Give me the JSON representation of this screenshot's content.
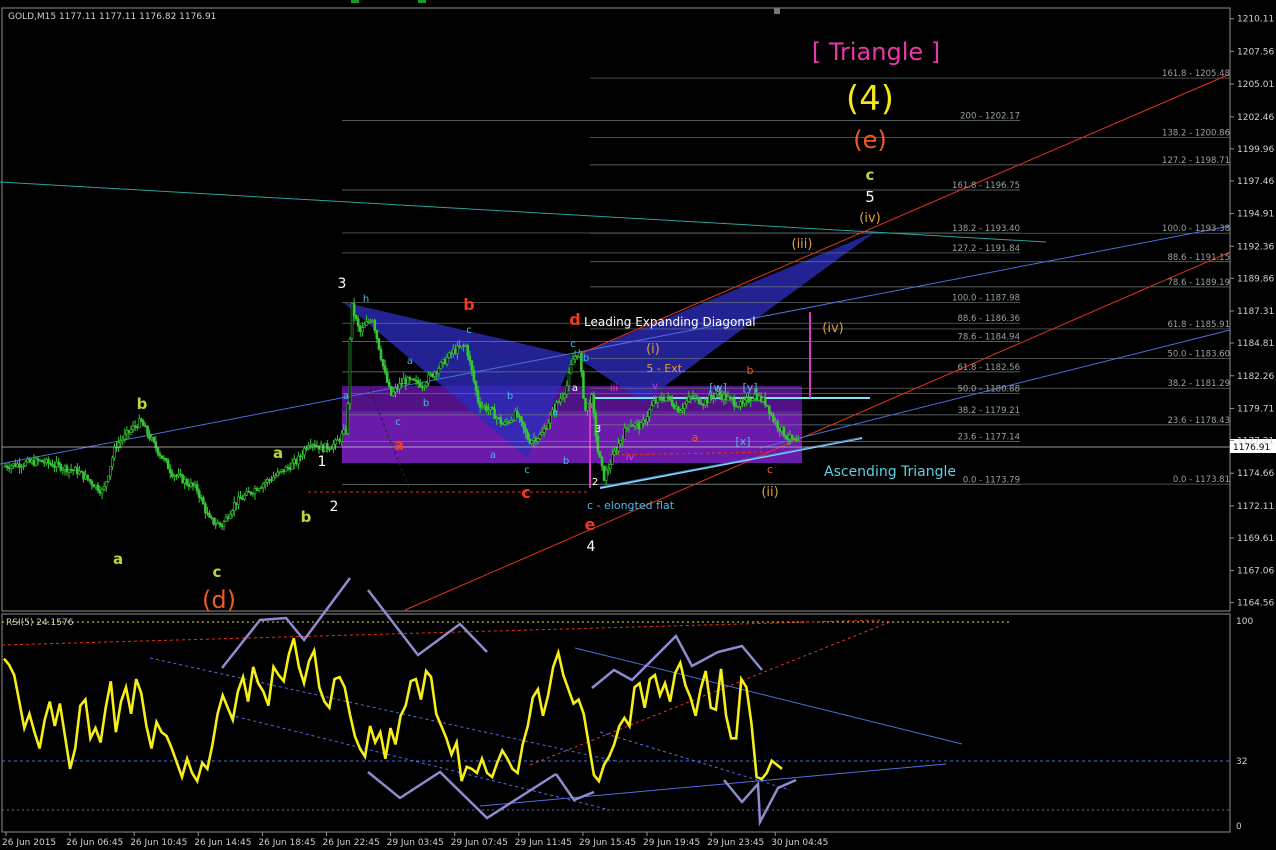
{
  "chart_data": {
    "type": "candlestick",
    "symbol_header": "GOLD,M15  1177.11 1177.11 1176.82 1176.91",
    "current_price_label": "1176.91",
    "price_axis": {
      "range": [
        1164.3,
        1210.4
      ],
      "ticks": [
        "1210.11",
        "1207.56",
        "1205.01",
        "1202.46",
        "1199.96",
        "1197.46",
        "1194.91",
        "1192.36",
        "1189.86",
        "1187.31",
        "1184.81",
        "1182.26",
        "1179.71",
        "1177.21",
        "1174.66",
        "1172.11",
        "1169.61",
        "1167.06",
        "1164.56"
      ]
    },
    "time_axis": {
      "ticks": [
        "26 Jun 2015",
        "26 Jun 06:45",
        "26 Jun 10:45",
        "26 Jun 14:45",
        "26 Jun 18:45",
        "26 Jun 22:45",
        "29 Jun 03:45",
        "29 Jun 07:45",
        "29 Jun 11:45",
        "29 Jun 15:45",
        "29 Jun 19:45",
        "29 Jun 23:45",
        "30 Jun 04:45"
      ]
    },
    "price_path": [
      [
        0,
        1175.2
      ],
      [
        6,
        1175.6
      ],
      [
        12,
        1174.8
      ],
      [
        16,
        1173.2
      ],
      [
        18,
        1176.8
      ],
      [
        21,
        1178.3
      ],
      [
        22,
        1178.7
      ],
      [
        24,
        1177.0
      ],
      [
        27,
        1174.7
      ],
      [
        31,
        1173.4
      ],
      [
        33,
        1171.0
      ],
      [
        35,
        1170.6
      ],
      [
        37,
        1172.3
      ],
      [
        41,
        1173.7
      ],
      [
        44,
        1174.6
      ],
      [
        47,
        1175.6
      ],
      [
        49,
        1177.2
      ],
      [
        51,
        1176.6
      ],
      [
        53,
        1176.9
      ],
      [
        55,
        1178.1
      ],
      [
        55.6,
        1187.9
      ],
      [
        57,
        1185.6
      ],
      [
        59,
        1186.9
      ],
      [
        61,
        1182.4
      ],
      [
        62,
        1180.7
      ],
      [
        64,
        1181.9
      ],
      [
        67,
        1181.6
      ],
      [
        70,
        1183.1
      ],
      [
        72,
        1184.2
      ],
      [
        74,
        1184.6
      ],
      [
        76,
        1180.1
      ],
      [
        78,
        1179.5
      ],
      [
        80,
        1178.4
      ],
      [
        82,
        1179.3
      ],
      [
        84,
        1177.2
      ],
      [
        86,
        1177.6
      ],
      [
        88,
        1179.6
      ],
      [
        90,
        1181.3
      ],
      [
        91,
        1183.5
      ],
      [
        92,
        1184.2
      ],
      [
        93,
        1179.5
      ],
      [
        94,
        1180.7
      ],
      [
        95,
        1176.5
      ],
      [
        96,
        1174.3
      ],
      [
        98,
        1176.6
      ],
      [
        100,
        1178.6
      ],
      [
        102,
        1178.3
      ],
      [
        104,
        1180.2
      ],
      [
        106,
        1180.6
      ],
      [
        108,
        1179.6
      ],
      [
        110,
        1180.6
      ],
      [
        112,
        1180.2
      ],
      [
        114,
        1180.9
      ],
      [
        116,
        1180.4
      ],
      [
        118,
        1179.9
      ],
      [
        120,
        1180.8
      ],
      [
        122,
        1180.1
      ],
      [
        123,
        1178.9
      ],
      [
        125,
        1177.6
      ],
      [
        127,
        1176.9
      ]
    ],
    "fib_levels_left": [
      "100.0 - 1187.98",
      "88.6 - 1186.36",
      "78.6 - 1184.94",
      "61.8 - 1182.56",
      "50.0 - 1180.88",
      "38.2 - 1179.21",
      "23.6 - 1177.14",
      "0.0 - 1173.79"
    ],
    "fib_levels_mid": [
      "200 - 1202.17",
      "161.8 - 1196.75",
      "138.2 - 1193.40",
      "127.2 - 1191.84"
    ],
    "fib_levels_right": [
      "161.8 - 1205.48",
      "138.2 - 1200.86",
      "127.2 - 1198.71",
      "100.0 - 1193.38",
      "88.6 - 1191.15",
      "78.6 - 1189.19",
      "61.8 - 1185.91",
      "50.0 - 1183.60",
      "38.2 - 1181.29",
      "23.6 - 1178.43",
      "0.0 - 1173.81"
    ],
    "annotations": {
      "title": "[ Triangle ]",
      "wave4": "(4)",
      "wave_e_big": "(e)",
      "wave_d_big": "(d)",
      "green_a1": "a",
      "green_b1": "b",
      "green_c1": "c",
      "green_a2": "a",
      "green_b2": "b",
      "green_c2": "c",
      "white_1": "1",
      "white_2": "2",
      "white_3": "3",
      "white_4": "4",
      "white_5": "5",
      "red_a": "a",
      "red_b": "b",
      "red_c": "c",
      "red_d": "d",
      "red_e": "e",
      "leading_diagonal": "Leading Expanding Diagonal",
      "five_ext": "5 - Ext.",
      "elongated_flat": "c - elongted flat",
      "ascending_triangle": "Ascending Triangle",
      "roman_i": "(i)",
      "roman_ii": "(ii)",
      "roman_iii": "(iii)",
      "roman_iv_a": "(iv)",
      "roman_iv_b": "(iv)",
      "w": "[w]",
      "x": "[x]",
      "y": "[y]",
      "cyan_h": "h",
      "cyan_a": "a",
      "cyan_b": "b",
      "cyan_c": "c",
      "cyan_c2": "c",
      "cyan_b2": "b",
      "cyan_a2": "a",
      "cyan_c3": "c",
      "cyan_a3": "a",
      "cyan_b3": "b",
      "cyan_c4": "c",
      "cyan_b4": "b",
      "cyan_a4": "a",
      "small_3": "3",
      "small_2": "2",
      "small_iii": "iii",
      "small_iv": "iv",
      "small_v": "v",
      "orange_a": "a",
      "orange_b": "b",
      "orange_c": "c"
    },
    "rsi": {
      "label": "RSI(5) 24.1576",
      "axis_labels": [
        "100",
        "32",
        "0"
      ],
      "range": [
        0,
        100
      ],
      "values": [
        82,
        79,
        74,
        61,
        48,
        55,
        46,
        38,
        52,
        61,
        49,
        60,
        44,
        28,
        38,
        59,
        62,
        43,
        48,
        41,
        58,
        71,
        46,
        61,
        68,
        55,
        72,
        65,
        49,
        38,
        51,
        46,
        44,
        38,
        31,
        24,
        33,
        26,
        22,
        31,
        28,
        40,
        55,
        64,
        58,
        52,
        66,
        73,
        61,
        78,
        70,
        66,
        59,
        78,
        74,
        71,
        84,
        92,
        78,
        70,
        81,
        86,
        68,
        61,
        58,
        72,
        73,
        68,
        55,
        44,
        38,
        34,
        49,
        41,
        46,
        33,
        48,
        40,
        54,
        59,
        71,
        72,
        62,
        76,
        73,
        55,
        49,
        43,
        35,
        41,
        22,
        29,
        28,
        26,
        33,
        26,
        24,
        31,
        37,
        33,
        28,
        26,
        40,
        49,
        63,
        67,
        54,
        64,
        78,
        85,
        74,
        67,
        60,
        62,
        55,
        40,
        25,
        22,
        30,
        34,
        40,
        49,
        53,
        49,
        68,
        70,
        58,
        72,
        74,
        64,
        70,
        61,
        75,
        80,
        69,
        63,
        54,
        67,
        76,
        58,
        57,
        77,
        54,
        43,
        43,
        72,
        68,
        50,
        24,
        23,
        26,
        32,
        30,
        28
      ]
    }
  }
}
